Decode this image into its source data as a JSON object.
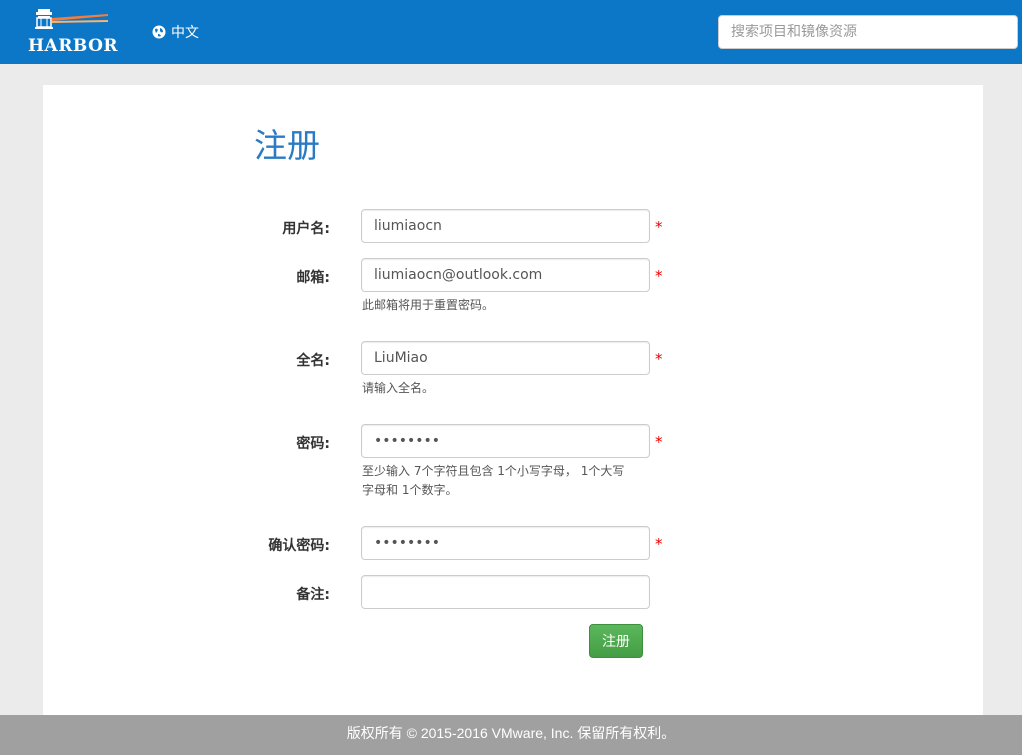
{
  "header": {
    "logo_text": "HARBOR",
    "language_label": "中文",
    "search_placeholder": "搜索项目和镜像资源",
    "bar_color": "#0b77c6"
  },
  "form": {
    "title": "注册",
    "fields": {
      "username": {
        "label": "用户名:",
        "value": "liumiaocn",
        "required": "*"
      },
      "email": {
        "label": "邮箱:",
        "value": "liumiaocn@outlook.com",
        "required": "*",
        "hint": "此邮箱将用于重置密码。"
      },
      "fullname": {
        "label": "全名:",
        "value": "LiuMiao",
        "required": "*",
        "hint": "请输入全名。"
      },
      "password": {
        "label": "密码:",
        "value": "••••••••",
        "required": "*",
        "hint_line1": "至少输入 7个字符且包含 1个小写字母， 1个大写",
        "hint_line2": "字母和 1个数字。"
      },
      "confirm_password": {
        "label": "确认密码:",
        "value": "••••••••",
        "required": "*"
      },
      "comment": {
        "label": "备注:",
        "value": ""
      }
    },
    "submit_label": "注册",
    "submit_color": "#5cb85c"
  },
  "footer": {
    "text": "版权所有 © 2015-2016 VMware, Inc. 保留所有权利。"
  }
}
